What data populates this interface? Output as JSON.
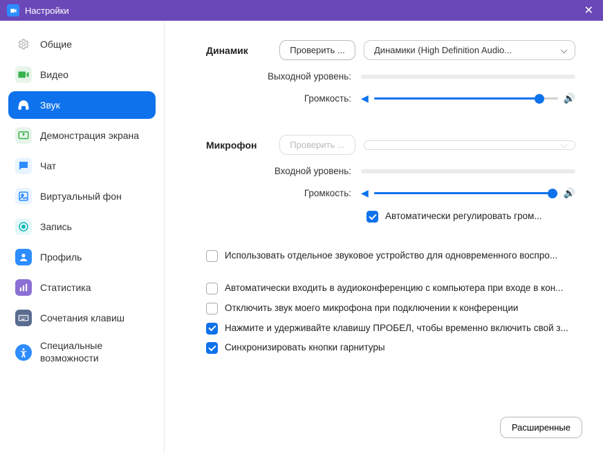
{
  "window": {
    "title": "Настройки"
  },
  "sidebar": {
    "items": [
      {
        "label": "Общие"
      },
      {
        "label": "Видео"
      },
      {
        "label": "Звук"
      },
      {
        "label": "Демонстрация экрана"
      },
      {
        "label": "Чат"
      },
      {
        "label": "Виртуальный фон"
      },
      {
        "label": "Запись"
      },
      {
        "label": "Профиль"
      },
      {
        "label": "Статистика"
      },
      {
        "label": "Сочетания клавиш"
      },
      {
        "label": "Специальные возможности"
      }
    ]
  },
  "audio": {
    "speaker": {
      "title": "Динамик",
      "test_button": "Проверить ...",
      "device": "Динамики (High Definition Audio...",
      "output_level_label": "Выходной уровень:",
      "volume_label": "Громкость:",
      "volume_percent": 90
    },
    "microphone": {
      "title": "Микрофон",
      "test_button": "Проверить ...",
      "device": "",
      "input_level_label": "Входной уровень:",
      "volume_label": "Громкость:",
      "volume_percent": 97,
      "auto_adjust_label": "Автоматически регулировать гром...",
      "auto_adjust_checked": true
    },
    "options": [
      {
        "label": "Использовать отдельное звуковое устройство для одновременного воспро...",
        "checked": false
      },
      {
        "label": "Автоматически входить в аудиоконференцию с компьютера при входе в кон...",
        "checked": false
      },
      {
        "label": "Отключить звук моего микрофона при подключении к конференции",
        "checked": false
      },
      {
        "label": "Нажмите и удерживайте клавишу ПРОБЕЛ, чтобы временно включить свой з...",
        "checked": true
      },
      {
        "label": "Синхронизировать кнопки гарнитуры",
        "checked": true
      }
    ],
    "advanced_button": "Расширенные"
  }
}
